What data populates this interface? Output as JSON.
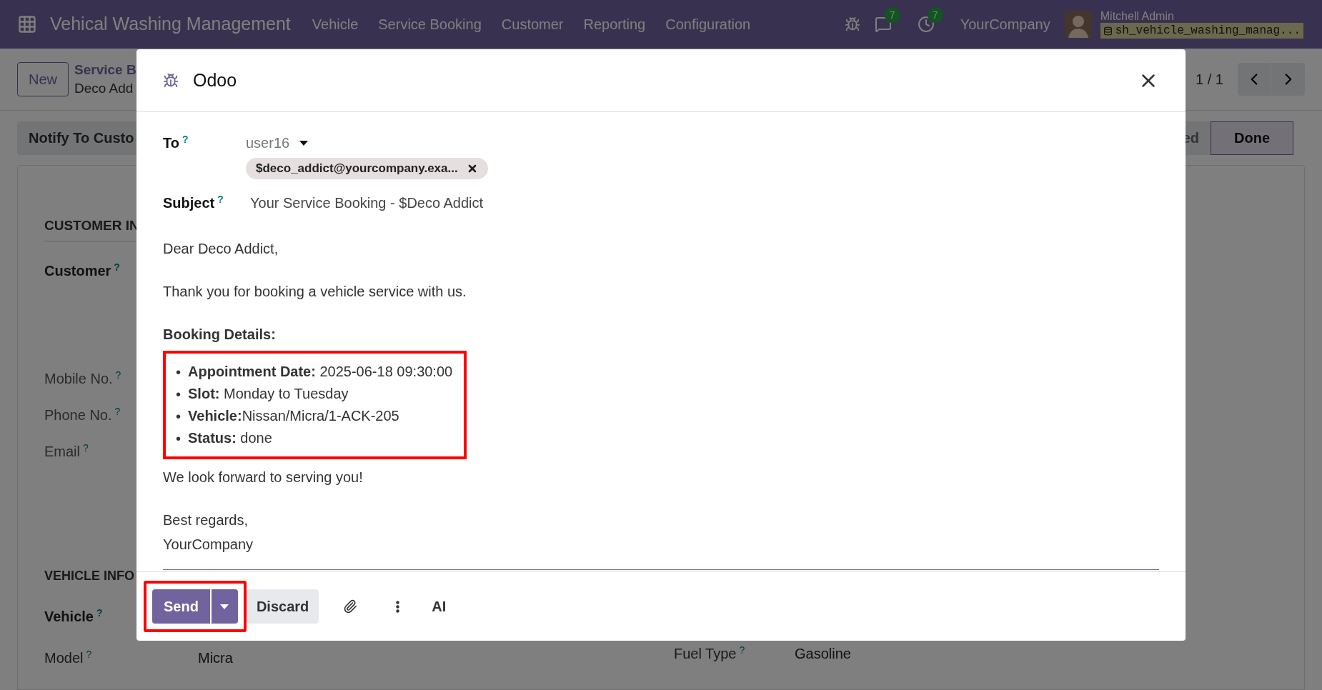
{
  "navbar": {
    "app_title": "Vehical Washing Management",
    "menu": [
      "Vehicle",
      "Service Booking",
      "Customer",
      "Reporting",
      "Configuration"
    ],
    "notifications": [
      {
        "kind": "chat",
        "count": "7"
      },
      {
        "kind": "activity",
        "count": "7"
      }
    ],
    "company": "YourCompany",
    "user": {
      "name": "Mitchell Admin",
      "database": "sh_vehicle_washing_manag..."
    }
  },
  "background": {
    "new_button": "New",
    "breadcrumb": [
      "Service B",
      "Deco Add"
    ],
    "pager": "1 / 1",
    "action_button": "Notify To Custo",
    "stages": [
      {
        "label": "ed",
        "selected": false
      },
      {
        "label": "Done",
        "selected": true
      }
    ],
    "customer_section": {
      "title": "CUSTOMER IN",
      "fields": [
        {
          "label": "Customer",
          "help": "?",
          "strong": true
        },
        {
          "label": "Mobile No.",
          "help": "?",
          "strong": false
        },
        {
          "label": "Phone No.",
          "help": "?",
          "strong": false
        },
        {
          "label": "Email",
          "help": "?",
          "strong": false
        }
      ]
    },
    "vehicle_section": {
      "title": "VEHICLE INFO",
      "fields": [
        {
          "label": "Vehicle",
          "help": "?"
        }
      ],
      "model": {
        "label": "Model",
        "help": "?",
        "value": "Micra"
      },
      "fuel_type": {
        "label": "Fuel Type",
        "help": "?",
        "value": "Gasoline"
      }
    }
  },
  "dialog": {
    "title": "Odoo",
    "to": {
      "label": "To",
      "help": "?",
      "value": "user16",
      "recipients": [
        "$deco_addict@yourcompany.exa..."
      ]
    },
    "subject": {
      "label": "Subject",
      "help": "?",
      "value": "Your Service Booking - $Deco Addict"
    },
    "body": {
      "greeting": "Dear Deco Addict,",
      "intro": "Thank you for booking a vehicle service with us.",
      "details_heading": "Booking Details:",
      "bullet": "•",
      "details": [
        "**Appointment Date:** 2025-06-18 09:30:00",
        "**Slot:** Monday to Tuesday",
        "**Vehicle:**Nissan/Micra/1-ACK-205",
        "**Status:** done"
      ],
      "details_highlighted": true,
      "closing": "We look forward to serving you!",
      "sign_off": "Best regards,",
      "signature": "YourCompany"
    },
    "buttons": {
      "send": "Send",
      "discard": "Discard",
      "ai": "AI",
      "send_highlighted": true
    }
  }
}
